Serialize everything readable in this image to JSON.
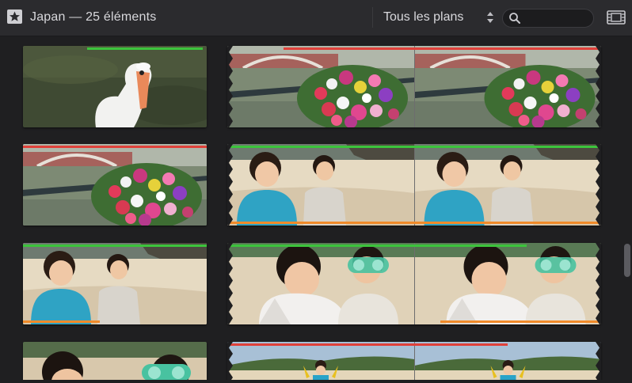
{
  "toolbar": {
    "title": "Japan — 25 éléments",
    "filter_label": "Tous les plans",
    "search_placeholder": "",
    "icons": {
      "star": "star-icon",
      "updown": "updown-icon",
      "search": "search-icon",
      "film": "filmstrip-icon"
    }
  },
  "colors": {
    "favorite": "#3cc43c",
    "rejected": "#e0413a",
    "keyword": "#f08a2a",
    "edge": "#7aa6c8"
  },
  "clips": [
    {
      "scenes": [
        "swan"
      ],
      "marks": [
        "favorite"
      ]
    },
    {
      "scenes": [
        "flowers",
        "flowers"
      ],
      "marks": [
        "rejected"
      ]
    },
    {
      "scenes": [
        "flowers"
      ],
      "marks": [
        "rejected"
      ]
    },
    {
      "scenes": [
        "kids-beach",
        "kids-beach"
      ],
      "marks": [
        "favorite",
        "keyword"
      ]
    },
    {
      "scenes": [
        "kids-beach"
      ],
      "marks": [
        "favorite",
        "keyword"
      ]
    },
    {
      "scenes": [
        "goggles",
        "goggles"
      ],
      "marks": [
        "favorite",
        "keyword"
      ]
    },
    {
      "scenes": [
        "goggles-row"
      ],
      "marks": []
    },
    {
      "scenes": [
        "beach-run",
        "beach-run"
      ],
      "marks": [
        "rejected"
      ]
    }
  ]
}
